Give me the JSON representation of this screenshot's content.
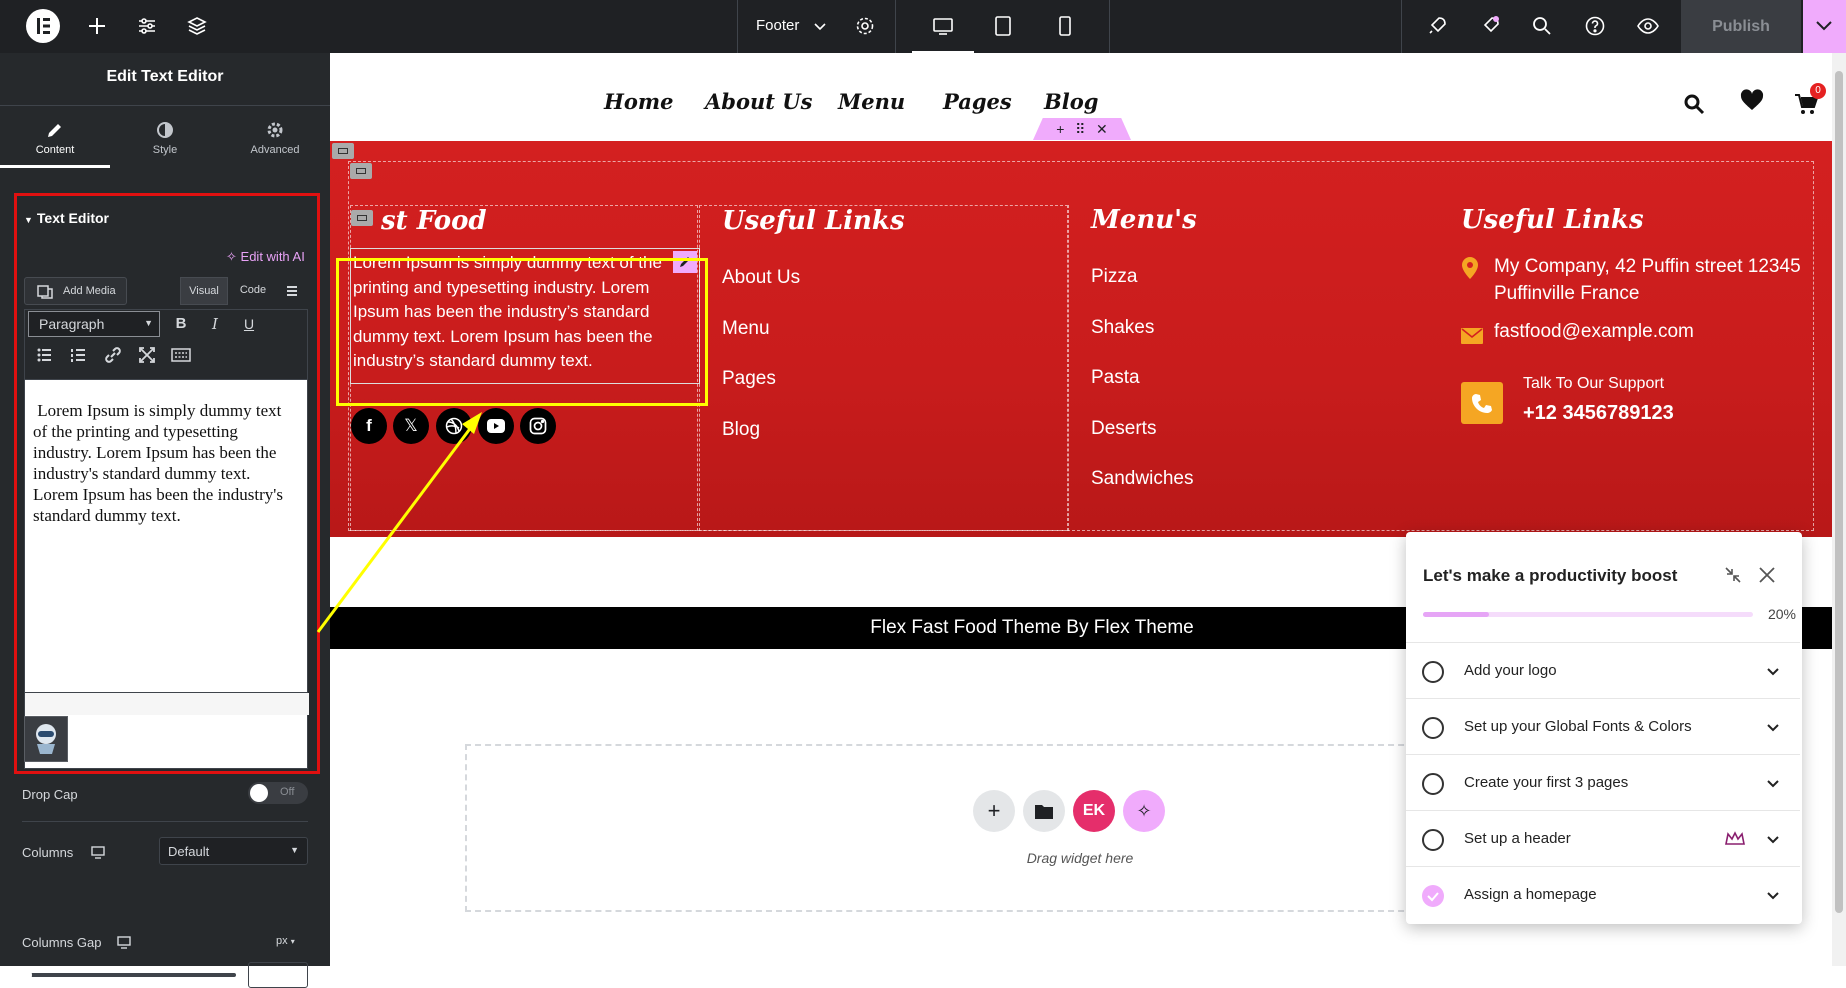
{
  "topbar": {
    "document_name": "Footer",
    "publish_label": "Publish",
    "icons": [
      "elementor-logo-icon",
      "plus-icon",
      "sliders-icon",
      "layers-icon",
      "chevron-down-icon",
      "gear-icon",
      "desktop-icon",
      "tablet-icon",
      "mobile-icon",
      "rocket-icon",
      "notification-icon",
      "search-icon",
      "help-icon",
      "eye-icon",
      "chevron-down-icon"
    ]
  },
  "panel": {
    "title": "Edit Text Editor",
    "tabs": [
      {
        "label": "Content",
        "icon": "pencil-icon",
        "active": true
      },
      {
        "label": "Style",
        "icon": "half-circle-icon",
        "active": false
      },
      {
        "label": "Advanced",
        "icon": "gear-icon",
        "active": false
      }
    ],
    "section_title": "Text Editor",
    "edit_ai_label": "Edit with AI",
    "add_media_label": "Add Media",
    "visual_tab": "Visual",
    "code_tab": "Code",
    "format_select": "Paragraph",
    "editor_text": " Lorem Ipsum is simply dummy text of the printing and typesetting industry. Lorem Ipsum has been the industry's standard dummy text. Lorem Ipsum has been the industry's standard dummy text.",
    "drop_cap_label": "Drop Cap",
    "drop_cap_state": "Off",
    "columns_label": "Columns",
    "columns_value": "Default",
    "columns_gap_label": "Columns Gap",
    "columns_gap_unit": "px"
  },
  "site": {
    "nav": [
      "Home",
      "About Us",
      "Menu",
      "Pages",
      "Blog"
    ],
    "cart_count": "0",
    "footer": {
      "brand_heading": "st Food",
      "brand_text": "Lorem Ipsum is simply dummy text of the printing and typesetting industry. Lorem Ipsum has been the industry’s standard dummy text. Lorem Ipsum has been the industry’s standard dummy text.",
      "col2_heading": "Useful Links",
      "col2_links": [
        "About Us",
        "Menu",
        "Pages",
        "Blog"
      ],
      "col3_heading": "Menu's",
      "col3_links": [
        "Pizza",
        "Shakes",
        "Pasta",
        "Deserts",
        "Sandwiches"
      ],
      "col4_heading": "Useful Links",
      "address_line1": "My Company, 42 Puffin street 12345",
      "address_line2": "Puffinville France",
      "email": "fastfood@example.com",
      "support_label": "Talk To Our Support",
      "support_phone": "+12 3456789123",
      "copyright": "Flex Fast Food Theme By Flex Theme",
      "accent_color": "#d42020"
    },
    "drag_widget_label": "Drag widget here"
  },
  "checklist": {
    "title": "Let's make a productivity boost",
    "progress_label": "20%",
    "progress_value": 0.2,
    "items": [
      {
        "label": "Add your logo",
        "done": false
      },
      {
        "label": "Set up your Global Fonts & Colors",
        "done": false
      },
      {
        "label": "Create your first 3 pages",
        "done": false
      },
      {
        "label": "Set up a header",
        "done": false,
        "pro": true
      },
      {
        "label": "Assign a homepage",
        "done": true
      }
    ]
  }
}
